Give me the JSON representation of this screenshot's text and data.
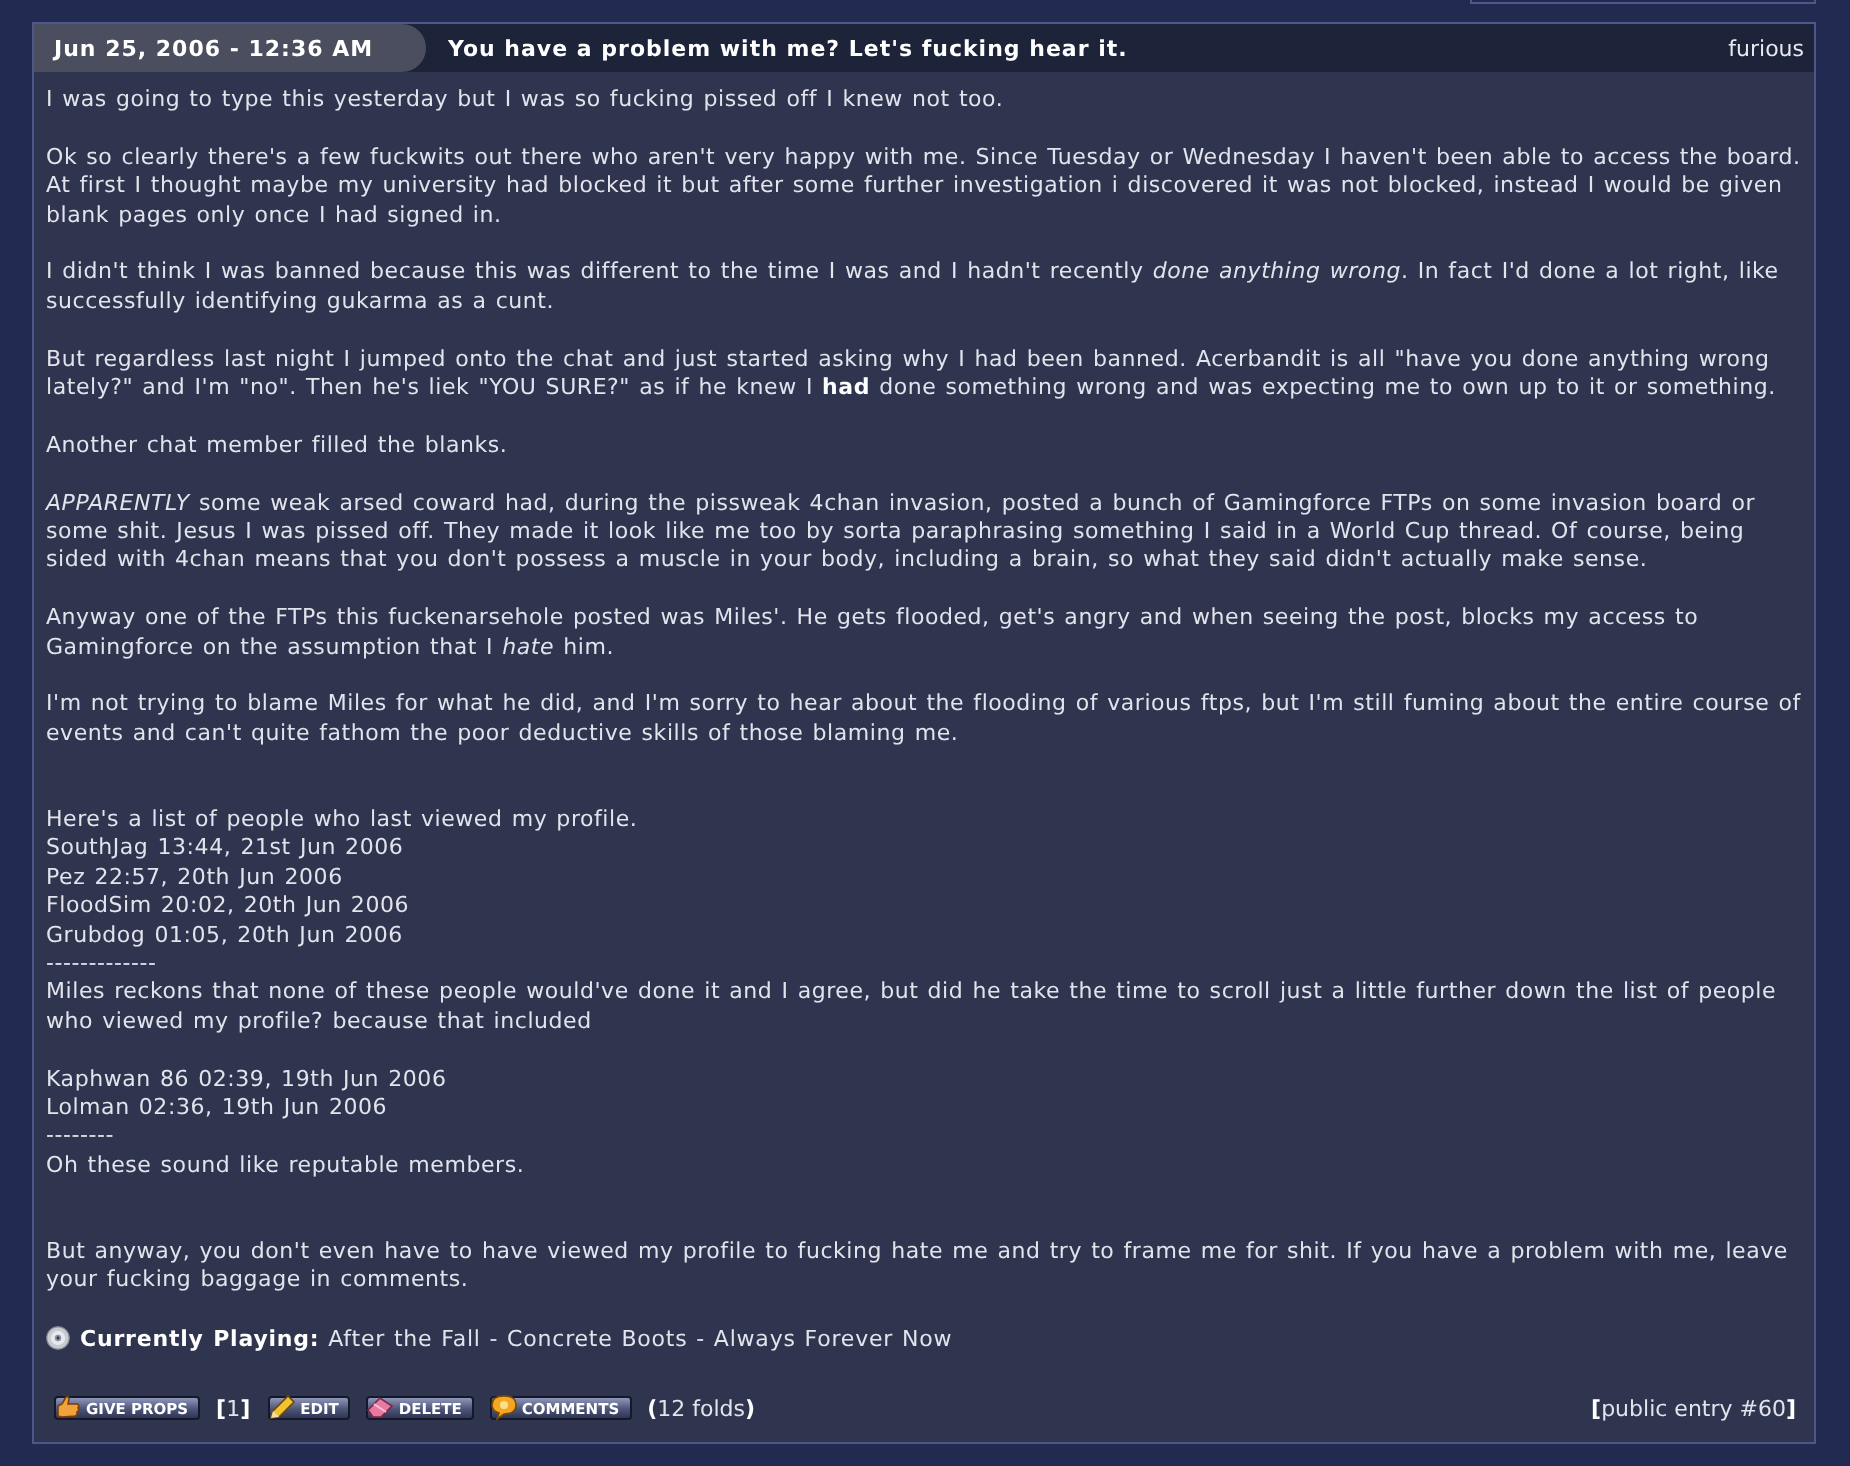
{
  "entry": {
    "date": "Jun 25, 2006 - 12:36 AM",
    "title": "You have a problem with me? Let's fucking hear it.",
    "mood": "furious",
    "body": [
      {
        "kind": "paragraph",
        "lines": [
          "I was going to type this yesterday but I was so fucking pissed off I knew not too."
        ]
      },
      {
        "kind": "paragraph",
        "lines": [
          "Ok so clearly there's a few fuckwits out there who aren't very happy with me. Since Tuesday or Wednesday I haven't been able to access the board. At first I thought maybe my university had blocked it but after some further investigation i discovered it was not blocked, instead I would be given blank pages only once I had signed in."
        ]
      },
      {
        "kind": "paragraph",
        "lines": [
          "I didn't think I was banned because this was different to the time I was and I hadn't recently *done anything wrong*. In fact I'd done a lot right, like successfully identifying gukarma as a cunt."
        ]
      },
      {
        "kind": "paragraph",
        "lines": [
          "But regardless last night I jumped onto the chat and just started asking why I had been banned. Acerbandit is all \"have you done anything wrong lately?\" and I'm \"no\". Then he's liek \"YOU SURE?\" as if he knew I **had** done something wrong and was expecting me to own up to it or something."
        ]
      },
      {
        "kind": "paragraph",
        "lines": [
          "Another chat member filled the blanks."
        ]
      },
      {
        "kind": "paragraph",
        "lines": [
          "*APPARENTLY* some weak arsed coward had, during the pissweak 4chan invasion, posted a bunch of Gamingforce FTPs on some invasion board or some shit. Jesus I was pissed off. They made it look like me too by sorta paraphrasing something I said in a World Cup thread. Of course, being sided with 4chan means that you don't possess a muscle in your body, including a brain, so what they said didn't actually make sense."
        ]
      },
      {
        "kind": "paragraph",
        "lines": [
          "Anyway one of the FTPs this fuckenarsehole posted was Miles'. He gets flooded, get's angry and when seeing the post, blocks my access to Gamingforce on the assumption that I *hate* him."
        ]
      },
      {
        "kind": "paragraph",
        "lines": [
          "I'm not trying to blame Miles for what he did, and I'm sorry to hear about the flooding of various ftps, but I'm still fuming about the entire course of events and can't quite fathom the poor deductive skills of those blaming me."
        ]
      },
      {
        "kind": "section",
        "lines": [
          "Here's a list of people who last viewed my profile.",
          "SouthJag 13:44, 21st Jun 2006",
          "Pez 22:57, 20th Jun 2006",
          "FloodSim 20:02, 20th Jun 2006",
          "Grubdog 01:05, 20th Jun 2006",
          "-------------",
          "Miles reckons that none of these people would've done it and I agree, but did he take the time to scroll just a little further down the list of people who viewed my profile? because that included"
        ]
      },
      {
        "kind": "paragraph",
        "lines": [
          "Kaphwan 86 02:39, 19th Jun 2006",
          "Lolman 02:36, 19th Jun 2006",
          "--------",
          "Oh these sound like reputable members."
        ]
      },
      {
        "kind": "section",
        "lines": [
          "But anyway, you don't even have to have viewed my profile to fucking hate me and try to frame me for shit. If you have a problem with me, leave your fucking baggage in comments."
        ]
      }
    ],
    "currently_playing": "**Currently Playing:** After the Fall - Concrete Boots - Always Forever Now",
    "actions": [
      {
        "kind": "props",
        "label": "GIVE PROPS"
      },
      {
        "kind": "count",
        "text": "**[**1**]**"
      },
      {
        "kind": "edit",
        "label": "EDIT"
      },
      {
        "kind": "delete",
        "label": "DELETE"
      },
      {
        "kind": "comments",
        "label": "COMMENTS"
      },
      {
        "kind": "count",
        "text": "**(**12 folds**)**"
      }
    ],
    "entry_info": "**[**public entry #60**]**"
  }
}
